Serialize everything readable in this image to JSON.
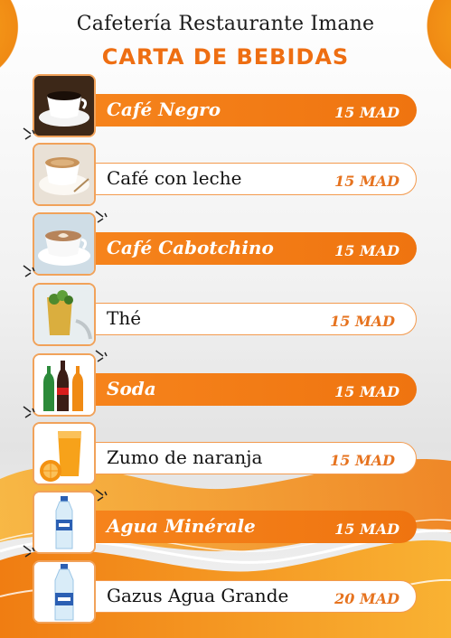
{
  "header": {
    "shop_name": "Cafetería Restaurante Imane",
    "menu_title": "CARTA DE BEBIDAS"
  },
  "colors": {
    "accent": "#ef7410",
    "accent_light": "#f7a21a",
    "price_on_white": "#e6731f"
  },
  "items": [
    {
      "name": "Café Negro",
      "price": "15 MAD",
      "style": "orange",
      "icon": "black-coffee-cup-icon"
    },
    {
      "name": "Café con leche",
      "price": "15 MAD",
      "style": "white",
      "icon": "coffee-with-milk-icon"
    },
    {
      "name": "Café Cabotchino",
      "price": "15 MAD",
      "style": "orange",
      "icon": "cappuccino-icon"
    },
    {
      "name": "Thé",
      "price": "15 MAD",
      "style": "white",
      "icon": "mint-tea-glass-icon"
    },
    {
      "name": "Soda",
      "price": "15 MAD",
      "style": "orange",
      "icon": "soda-bottles-icon"
    },
    {
      "name": "Zumo de naranja",
      "price": "15 MAD",
      "style": "white",
      "icon": "orange-juice-icon"
    },
    {
      "name": "Agua Minérale",
      "price": "15 MAD",
      "style": "orange",
      "icon": "water-bottle-icon"
    },
    {
      "name": "Gazus Agua Grande",
      "price": "20 MAD",
      "style": "white",
      "icon": "large-water-bottle-icon"
    }
  ]
}
